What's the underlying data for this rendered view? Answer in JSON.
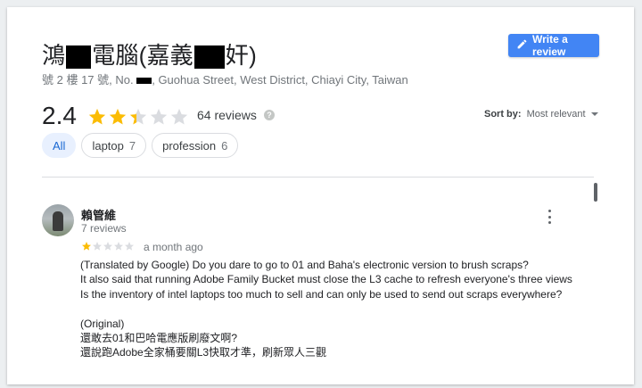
{
  "place": {
    "name_part1": "鴻",
    "name_part2": "電腦(嘉義",
    "name_part3": "奸)",
    "address_part1": "號 2 樓 17 號, No.",
    "address_part2": ", Guohua Street, West District, Chiayi City, Taiwan"
  },
  "actions": {
    "write_review_label": "Write a review"
  },
  "summary": {
    "rating": "2.4",
    "rating_value": 2.4,
    "review_count": "64 reviews"
  },
  "sort": {
    "label": "Sort by:",
    "value": "Most relevant"
  },
  "filters": [
    {
      "label": "All",
      "count": ""
    },
    {
      "label": "laptop",
      "count": "7"
    },
    {
      "label": "profession",
      "count": "6"
    }
  ],
  "review": {
    "author": "賴管維",
    "author_reviews": "7 reviews",
    "stars": 1,
    "date": "a month ago",
    "lines": [
      "(Translated by Google) Do you dare to go to 01 and Baha's electronic version to brush scraps?",
      "It also said that running Adobe Family Bucket must close the L3 cache to refresh everyone's three views",
      "Is the inventory of intel laptops too much to sell and can only be used to send out scraps everywhere?",
      "",
      "(Original)",
      "還敢去01和巴哈電應版刷廢文啊?",
      "還說跑Adobe全家桶要關L3快取才準，刷新眾人三觀"
    ]
  },
  "colors": {
    "accent": "#4285f4",
    "star": "#fbbc04",
    "star_empty": "#dadce0"
  }
}
